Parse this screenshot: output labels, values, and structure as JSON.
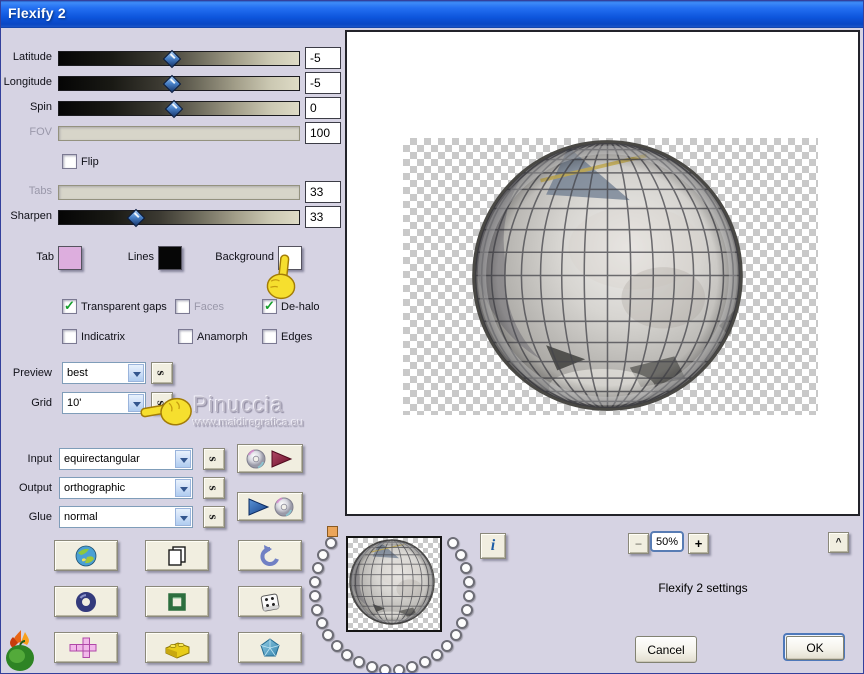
{
  "window": {
    "title": "Flexify 2"
  },
  "sliders": [
    {
      "label": "Latitude",
      "value": "-5",
      "percent": 47,
      "enabled": true
    },
    {
      "label": "Longitude",
      "value": "-5",
      "percent": 47,
      "enabled": true
    },
    {
      "label": "Spin",
      "value": "0",
      "percent": 48,
      "enabled": true
    },
    {
      "label": "FOV",
      "value": "100",
      "percent": null,
      "enabled": false
    },
    {
      "label": "Tabs",
      "value": "33",
      "percent": null,
      "enabled": false
    },
    {
      "label": "Sharpen",
      "value": "33",
      "percent": 32,
      "enabled": true
    }
  ],
  "flip": {
    "label": "Flip",
    "checked": false
  },
  "swatches": [
    {
      "label": "Tab",
      "color": "#ddaede"
    },
    {
      "label": "Lines",
      "color": "#060606"
    },
    {
      "label": "Background",
      "color": "#ffffff"
    }
  ],
  "checkboxes": [
    {
      "label": "Transparent gaps",
      "checked": true,
      "enabled": true
    },
    {
      "label": "Faces",
      "checked": false,
      "enabled": false
    },
    {
      "label": "De-halo",
      "checked": true,
      "enabled": true
    },
    {
      "label": "Indicatrix",
      "checked": false,
      "enabled": true
    },
    {
      "label": "Anamorph",
      "checked": false,
      "enabled": true
    },
    {
      "label": "Edges",
      "checked": false,
      "enabled": true
    }
  ],
  "check_glyph": "✓",
  "combos": {
    "preview": {
      "label": "Preview",
      "value": "best"
    },
    "grid": {
      "label": "Grid",
      "value": "10'"
    },
    "input": {
      "label": "Input",
      "value": "equirectangular"
    },
    "output": {
      "label": "Output",
      "value": "orthographic"
    },
    "glue": {
      "label": "Glue",
      "value": "normal"
    }
  },
  "s_button": "s",
  "watermark": {
    "name": "Pinuccia",
    "url": "www.maidiregrafica.eu"
  },
  "preview_pane": {
    "info": "i",
    "zoom_out": "−",
    "zoom_level": "50%",
    "zoom_in": "+",
    "collapse": "^"
  },
  "status_text": "Flexify 2 settings",
  "actions": {
    "cancel": "Cancel",
    "ok": "OK"
  },
  "colors": {
    "titlebar": "#0d55dc",
    "dialog_bg": "#d6d3e3",
    "selected_slot": "#eba55a",
    "checker_gray": "#c9c9c9",
    "globe_grid": "#44444a",
    "thumb_blue": "#4a83ca"
  }
}
